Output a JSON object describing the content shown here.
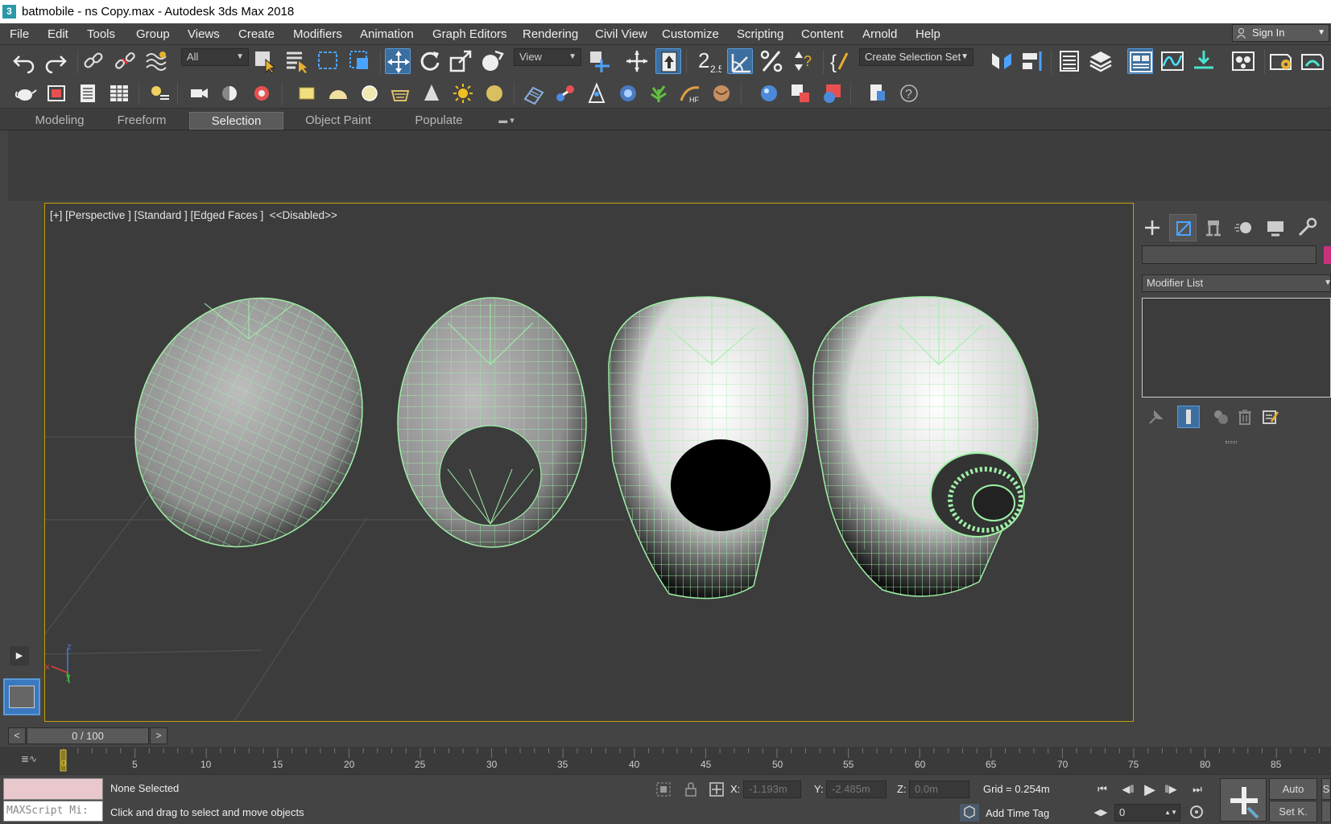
{
  "titlebar": {
    "app_icon": "3",
    "title": "batmobile - ns Copy.max - Autodesk 3ds Max 2018"
  },
  "menu": [
    "File",
    "Edit",
    "Tools",
    "Group",
    "Views",
    "Create",
    "Modifiers",
    "Animation",
    "Graph Editors",
    "Rendering",
    "Civil View",
    "Customize",
    "Scripting",
    "Content",
    "Arnold",
    "Help"
  ],
  "account": {
    "signin_label": "Sign In"
  },
  "toolbar": {
    "selection_filter": "All",
    "ref_coord_system": "View",
    "snap_angle_label": "2.5",
    "named_selection_placeholder": "Create Selection Set"
  },
  "ribbon": {
    "tabs": [
      "Modeling",
      "Freeform",
      "Selection",
      "Object Paint",
      "Populate"
    ],
    "active_tab": "Selection"
  },
  "viewport": {
    "label": "[+] [Perspective ] [Standard ] [Edged Faces ]  <<Disabled>>",
    "axis_labels": {
      "x": "x",
      "y": "y",
      "z": "z"
    },
    "wire_color": "#9ef0a6",
    "border_color": "#c8a000"
  },
  "command_panel": {
    "tabs": [
      "create-icon",
      "modify-icon",
      "hierarchy-icon",
      "motion-icon",
      "display-icon",
      "utilities-icon"
    ],
    "modifier_list_label": "Modifier List",
    "object_color": "#c8327d"
  },
  "timeline": {
    "frame_display": "0 / 100",
    "prev_label": "<",
    "next_label": ">",
    "ticks": [
      "0",
      "5",
      "10",
      "15",
      "20",
      "25",
      "30",
      "35",
      "40",
      "45",
      "50",
      "55",
      "60",
      "65",
      "70",
      "75",
      "80",
      "85"
    ]
  },
  "status": {
    "maxscript_placeholder": "MAXScript Mi:",
    "selection_status": "None Selected",
    "prompt": "Click and drag to select and move objects",
    "x_label": "X:",
    "x_value": "-1.193m",
    "y_label": "Y:",
    "y_value": "-2.485m",
    "z_label": "Z:",
    "z_value": "0.0m",
    "grid": "Grid = 0.254m",
    "add_time_tag": "Add Time Tag",
    "current_frame": "0",
    "auto_key": "Auto",
    "set_key": "Set K.",
    "right_stub_1": "S",
    "right_stub_2": "F"
  }
}
